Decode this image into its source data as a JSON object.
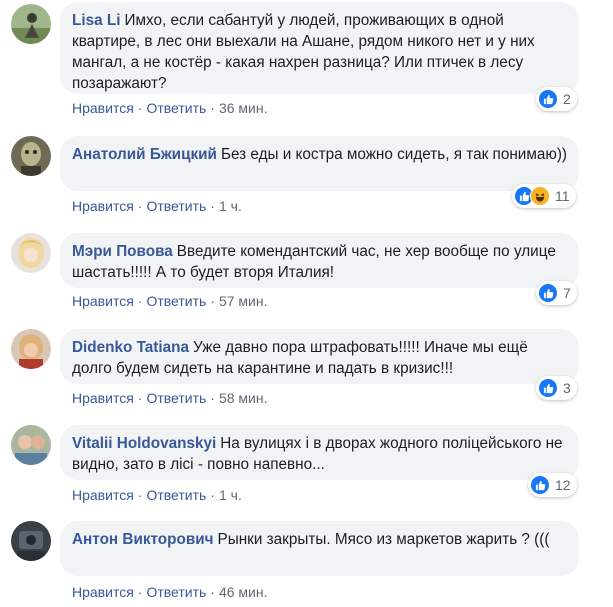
{
  "actions": {
    "like": "Нравится",
    "reply": "Ответить",
    "separator": "·"
  },
  "colors": {
    "author": "#385898",
    "bubble": "#f2f3f5",
    "like": "#1877f2",
    "haha": "#f7b125"
  },
  "comments": [
    {
      "author": "Lisa Li",
      "text": "Имхо, если сабантуй у людей, проживающих в одной квартире, в лес они выехали на Ашане, рядом никого нет и у них мангал, а не костёр - какая нахрен разница? Или птичек в лесу позаражают?",
      "time": "36 мин.",
      "reactions": [
        "like-icon"
      ],
      "count": "2"
    },
    {
      "author": "Анатолий Бжицкий",
      "text": "Без еды и костра можно сидеть, я так понимаю))",
      "time": "1 ч.",
      "reactions": [
        "like-icon",
        "haha-icon"
      ],
      "count": "11"
    },
    {
      "author": "Мэри Повова",
      "text": "Введите комендантский час, не хер вообще по улице шастать!!!!! А то будет вторя Италия!",
      "time": "57 мин.",
      "reactions": [
        "like-icon"
      ],
      "count": "7"
    },
    {
      "author": "Didenko Tatiana",
      "text": "Уже давно пора штрафовать!!!!! Иначе мы ещё долго будем сидеть на карантине и падать в кризис!!!",
      "time": "58 мин.",
      "reactions": [
        "like-icon"
      ],
      "count": "3"
    },
    {
      "author": "Vitalii Holdovanskyi",
      "text": "На вулицях і в дворах жодного поліцейського не видно, зато в лісі - повно напевно...",
      "time": "1 ч.",
      "reactions": [
        "like-icon"
      ],
      "count": "12"
    },
    {
      "author": "Антон Викторович",
      "text": "Рынки закрыты. Мясо из маркетов жарить ? (((",
      "time": "46 мин.",
      "reactions": [],
      "count": ""
    }
  ]
}
